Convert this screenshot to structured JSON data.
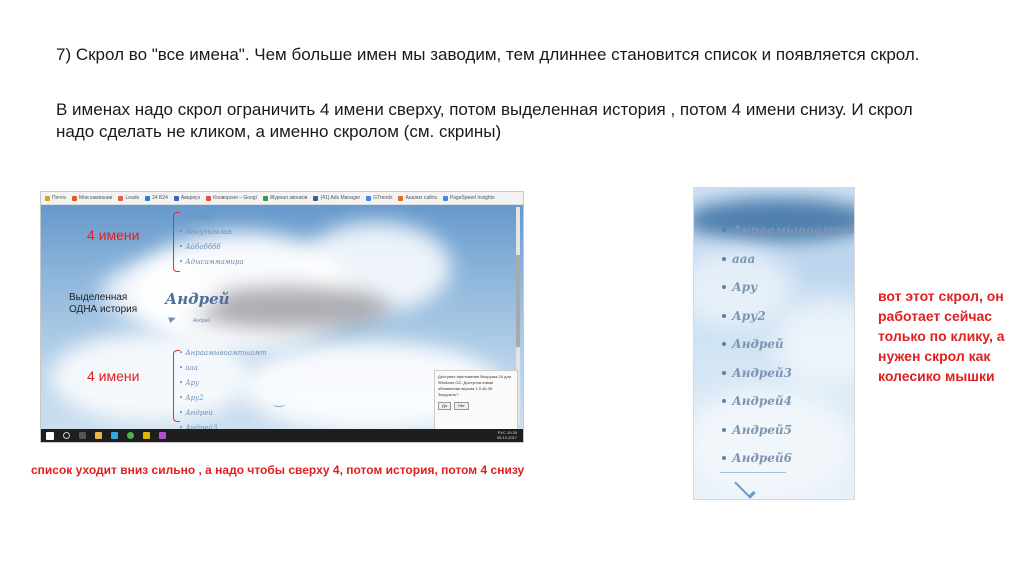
{
  "text": {
    "p1": "7) Скрол во \"все имена\". Чем больше имен мы заводим, тем длиннее становится список и появляется скрол.",
    "p2": "В именах надо скрол ограничить 4 имени сверху, потом выделенная история , потом 4 имени снизу. И скрол надо сделать не кликом, а именно скролом (см. скрины)",
    "right_note": "вот этот скрол, он работает сейчас только по клику, а нужен скрол как колесико мышки",
    "bottom_note": "список уходит вниз сильно , а надо чтобы сверху 4, потом история, потом 4 снизу"
  },
  "shot1": {
    "bookmarks": [
      {
        "label": "Почта",
        "color": "#e0a020"
      },
      {
        "label": "Мои кампании",
        "color": "#e05a20"
      },
      {
        "label": "Leads",
        "color": "#e06040"
      },
      {
        "label": "24 Б24",
        "color": "#2a7de1"
      },
      {
        "label": "Aвариуэ",
        "color": "#3a66c4"
      },
      {
        "label": "Конверсия – Googl",
        "color": "#e24c3c"
      },
      {
        "label": "Журнал звонков",
        "color": "#2f9e44"
      },
      {
        "label": "(41) Ads Manager",
        "color": "#3b5998"
      },
      {
        "label": "GTrends",
        "color": "#4285f4"
      },
      {
        "label": "Анализ сайта",
        "color": "#e86a1a"
      },
      {
        "label": "PageSpeed Insights",
        "color": "#4285f4"
      }
    ],
    "annot_top": "4 имени",
    "annot_bottom": "4 имени",
    "annot_selected": "Выделенная ОДНА история",
    "top_names": [
      "Андрей",
      "Анкуэыылав",
      "Айбабббб",
      "Адысаммамира"
    ],
    "selected_name": "Андрей",
    "selected_sub": "Андрей",
    "bottom_names": [
      "Анраамывоамтыамт",
      "ааа",
      "Ару",
      "Ару2",
      "Андрей",
      "Андрей3"
    ],
    "notification": {
      "text": "Доступно приложение Выгрузка 24 для Windows OC. Доступна новая обновление версия 1.0.46.39. Загрузить?",
      "yes": "Да",
      "no": "Нет"
    },
    "tray": {
      "lang": "РУС",
      "time": "10:35",
      "date": "05.10.2017"
    }
  },
  "shot2": {
    "names": [
      "Анраамывоамты",
      "ааа",
      "Ару",
      "Ару2",
      "Андрей",
      "Андрей3",
      "Андрей4",
      "Андрей5",
      "Андрей6"
    ]
  },
  "icons": {
    "send": "send-icon",
    "chevron": "chevron-down-icon"
  },
  "colors": {
    "annotation_red": "#e02020",
    "name_blue": "#6e8fb3"
  }
}
